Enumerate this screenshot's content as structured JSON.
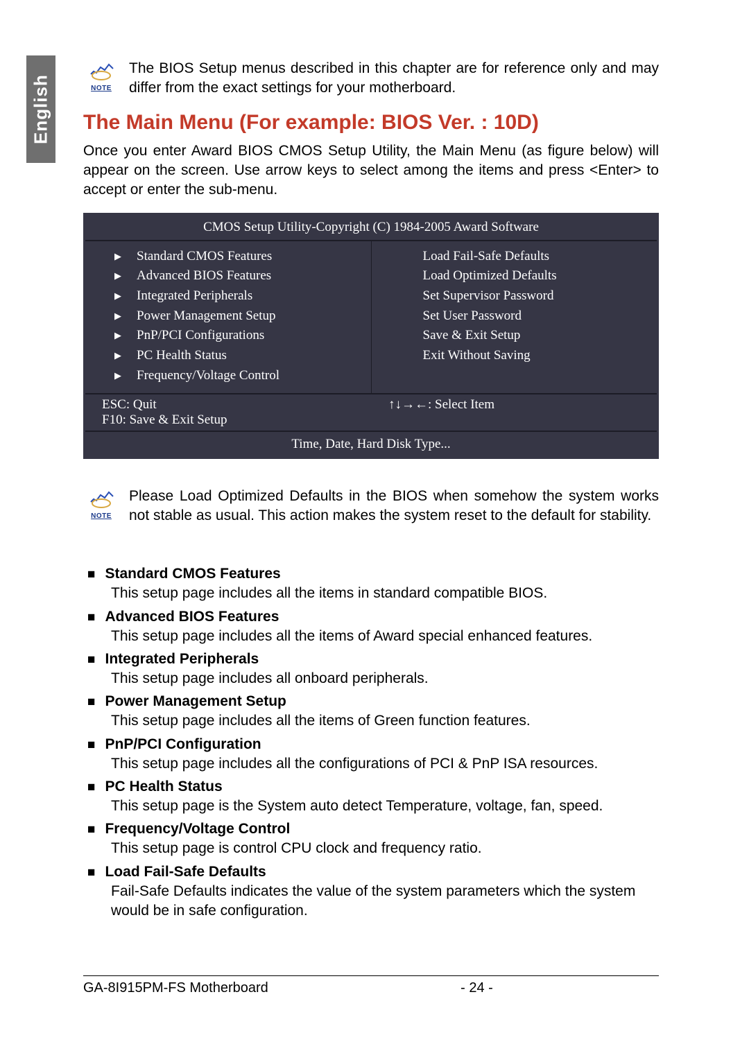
{
  "side_tab": "English",
  "note1": "The BIOS Setup menus described in this chapter are for reference only and may differ from the exact settings for your motherboard.",
  "note_label": "NOTE",
  "heading": "The Main Menu (For example: BIOS Ver. : 10D)",
  "intro_para": "Once you enter Award BIOS CMOS Setup Utility, the Main Menu (as figure below) will appear on the screen. Use arrow keys to select among the items and press <Enter> to accept or enter the sub-menu.",
  "bios": {
    "title": "CMOS Setup Utility-Copyright (C) 1984-2005 Award Software",
    "left_items": [
      "Standard CMOS Features",
      "Advanced BIOS Features",
      "Integrated Peripherals",
      "Power Management Setup",
      "PnP/PCI Configurations",
      "PC Health Status",
      "Frequency/Voltage Control"
    ],
    "right_items": [
      "Load Fail-Safe Defaults",
      "Load Optimized Defaults",
      "Set Supervisor Password",
      "Set User Password",
      "Save & Exit Setup",
      "Exit Without Saving"
    ],
    "help_esc": "ESC: Quit",
    "help_f10": "F10: Save & Exit Setup",
    "help_select": "↑↓→←: Select Item",
    "footer": "Time, Date, Hard Disk Type..."
  },
  "note2": "Please Load Optimized Defaults in the BIOS when somehow the system works not stable as usual. This action makes the system reset to the default for stability.",
  "sections": [
    {
      "title": "Standard CMOS Features",
      "desc": "This setup page includes all the items in standard compatible BIOS."
    },
    {
      "title": "Advanced BIOS Features",
      "desc": "This setup page includes all the items of Award special enhanced features."
    },
    {
      "title": "Integrated Peripherals",
      "desc": "This setup page includes all onboard peripherals."
    },
    {
      "title": "Power Management Setup",
      "desc": "This setup page includes all the items of Green function features."
    },
    {
      "title": "PnP/PCI Configuration",
      "desc": "This setup page includes all the configurations of PCI & PnP ISA resources."
    },
    {
      "title": "PC Health Status",
      "desc": "This setup page is the System auto detect Temperature, voltage, fan, speed."
    },
    {
      "title": "Frequency/Voltage Control",
      "desc": "This setup page is control CPU clock and frequency ratio."
    },
    {
      "title": "Load Fail-Safe Defaults",
      "desc": "Fail-Safe Defaults indicates the value of the system parameters which the system would be in safe configuration."
    }
  ],
  "footer": {
    "model": "GA-8I915PM-FS Motherboard",
    "page": "- 24 -"
  }
}
